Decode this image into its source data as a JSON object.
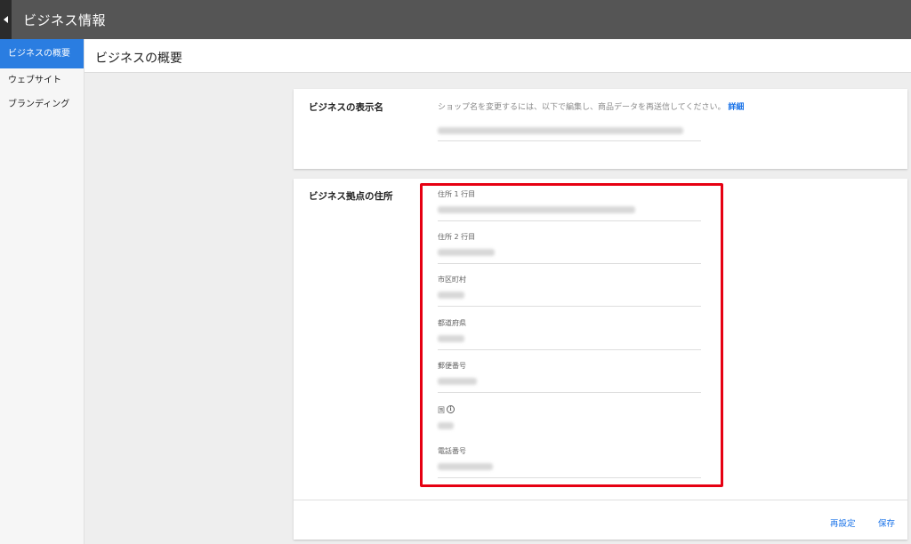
{
  "app": {
    "title": "ビジネス情報"
  },
  "sidebar": {
    "items": [
      {
        "label": "ビジネスの概要"
      },
      {
        "label": "ウェブサイト"
      },
      {
        "label": "ブランディング"
      }
    ]
  },
  "page": {
    "title": "ビジネスの概要"
  },
  "display_name": {
    "label": "ビジネスの表示名",
    "help_text": "ショップ名を変更するには、以下で編集し、商品データを再送信してください。",
    "help_link": "詳細"
  },
  "address": {
    "label": "ビジネス拠点の住所",
    "fields": [
      {
        "label": "住所 1 行目"
      },
      {
        "label": "住所 2 行目"
      },
      {
        "label": "市区町村"
      },
      {
        "label": "都道府県"
      },
      {
        "label": "郵便番号"
      },
      {
        "label": "国"
      },
      {
        "label": "電話番号"
      }
    ]
  },
  "footer": {
    "reset_label": "再設定",
    "save_label": "保存"
  },
  "colors": {
    "accent": "#2a7de1",
    "link": "#1a73e8",
    "highlight": "#e60012",
    "topbar": "#555555"
  },
  "icons": {
    "back": "chevron-left-icon",
    "info": "info-icon"
  }
}
